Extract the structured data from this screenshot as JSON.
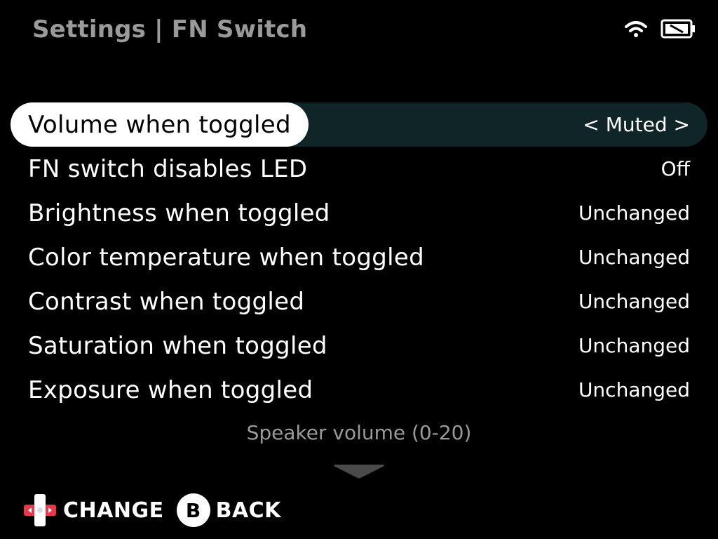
{
  "header": {
    "title": "Settings | FN Switch",
    "icons": [
      "wifi-icon",
      "battery-icon"
    ]
  },
  "menu": {
    "items": [
      {
        "label": "Volume when toggled",
        "value": "< Muted >",
        "selected": true
      },
      {
        "label": "FN switch disables LED",
        "value": "Off"
      },
      {
        "label": "Brightness when toggled",
        "value": "Unchanged"
      },
      {
        "label": "Color temperature when toggled",
        "value": "Unchanged"
      },
      {
        "label": "Contrast when toggled",
        "value": "Unchanged"
      },
      {
        "label": "Saturation when toggled",
        "value": "Unchanged"
      },
      {
        "label": "Exposure when toggled",
        "value": "Unchanged"
      }
    ]
  },
  "hint": "Speaker volume (0-20)",
  "footer": {
    "change_label": "CHANGE",
    "b_glyph": "B",
    "back_label": "BACK"
  },
  "colors": {
    "background": "#000000",
    "selected_row": "#0f2528",
    "dim_text": "#9a9a9a",
    "dpad_red": "#e8384a"
  }
}
